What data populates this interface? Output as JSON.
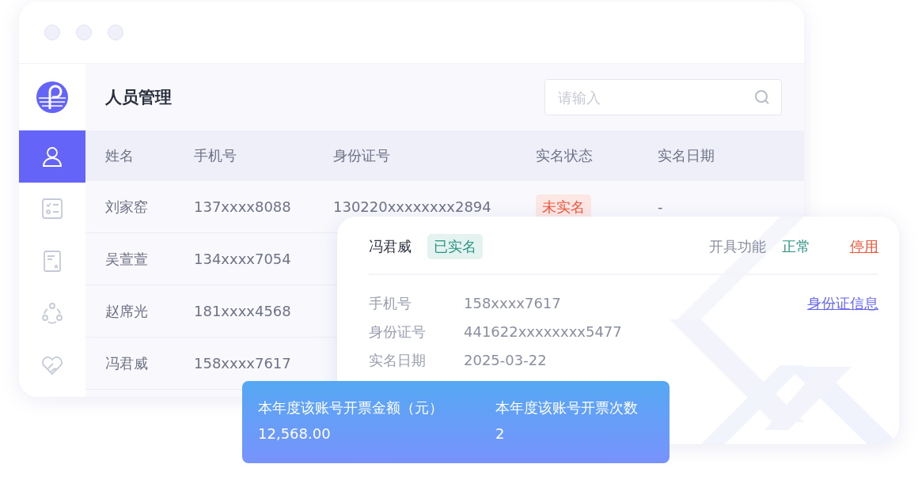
{
  "sidebar": {
    "items": [
      {
        "kind": "user",
        "selected": true
      },
      {
        "kind": "checklist",
        "selected": false
      },
      {
        "kind": "certificate",
        "selected": false
      },
      {
        "kind": "network",
        "selected": false
      },
      {
        "kind": "care",
        "selected": false
      }
    ]
  },
  "header": {
    "title": "人员管理",
    "search": {
      "placeholder": "请输入"
    }
  },
  "table": {
    "columns": [
      "姓名",
      "手机号",
      "身份证号",
      "实名状态",
      "实名日期"
    ],
    "rows": [
      {
        "name": "刘家窑",
        "phone": "137xxxx8088",
        "id_number": "130220xxxxxxxx2894",
        "status": {
          "text": "未实名",
          "verified": false
        },
        "date": "-"
      },
      {
        "name": "吴萱萱",
        "phone": "134xxxx7054"
      },
      {
        "name": "赵席光",
        "phone": "181xxxx4568"
      },
      {
        "name": "冯君威",
        "phone": "158xxxx7617"
      }
    ]
  },
  "detail": {
    "name": "冯君威",
    "status": {
      "text": "已实名",
      "verified": true
    },
    "function_label": "开具功能",
    "function_status": "正常",
    "action": "停用",
    "link": "身份证信息",
    "fields": [
      {
        "label": "手机号",
        "value": "158xxxx7617"
      },
      {
        "label": "身份证号",
        "value": "441622xxxxxxxx5477"
      },
      {
        "label": "实名日期",
        "value": "2025-03-22"
      }
    ]
  },
  "stats": [
    {
      "label": "本年度该账号开票金额（元）",
      "value": "12,568.00"
    },
    {
      "label": "本年度该账号开票次数",
      "value": "2"
    }
  ]
}
